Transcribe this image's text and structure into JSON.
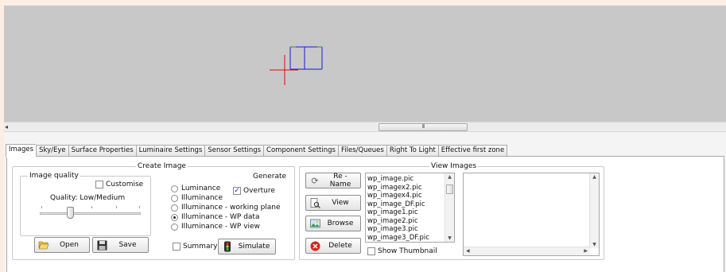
{
  "scrollbar": {
    "grip": "III"
  },
  "tabs": [
    {
      "label": "Images",
      "active": true
    },
    {
      "label": "Sky/Eye"
    },
    {
      "label": "Surface Properties"
    },
    {
      "label": "Luminaire Settings"
    },
    {
      "label": "Sensor Settings"
    },
    {
      "label": "Component Settings"
    },
    {
      "label": "Files/Queues"
    },
    {
      "label": "Right To Light"
    },
    {
      "label": "Effective first zone"
    }
  ],
  "create_image": {
    "title": "Create Image",
    "image_quality": {
      "title": "Image quality",
      "customise_label": "Customise",
      "customise_checked": false,
      "quality_label": "Quality: Low/Medium",
      "quality_level": 0.33
    },
    "generate": {
      "title": "Generate",
      "options": [
        "Luminance",
        "Illuminance",
        "Illuminance - working plane",
        "Illuminance - WP data",
        "Illuminance - WP view"
      ],
      "selected": "Illuminance - WP data",
      "overture_label": "Overture",
      "overture_checked": true
    },
    "open_label": "Open",
    "save_label": "Save",
    "summary_label": "Summary",
    "summary_checked": false,
    "simulate_label": "Simulate"
  },
  "view_images": {
    "title": "View Images",
    "rename_label": "Re - Name",
    "view_label": "View",
    "browse_label": "Browse",
    "delete_label": "Delete",
    "files": [
      "wp_image.pic",
      "wp_imagex2.pic",
      "wp_imagex4.pic",
      "wp_image_DF.pic",
      "wp_image1.pic",
      "wp_image2.pic",
      "wp_image3.pic",
      "wp_image3_DF.pic"
    ],
    "show_thumbnail_label": "Show Thumbnail",
    "show_thumbnail_checked": false
  },
  "icons": {
    "rename": "refresh-icon",
    "view": "magnifier-document-icon",
    "browse": "image-browse-icon",
    "delete": "delete-icon",
    "open": "folder-open-icon",
    "save": "floppy-disk-icon",
    "simulate": "traffic-light-icon"
  },
  "colors": {
    "viewport": "#c8c8c8",
    "axis_x": "#d01010",
    "axis_z": "#1a1ad0",
    "delete": "#d2261e"
  }
}
